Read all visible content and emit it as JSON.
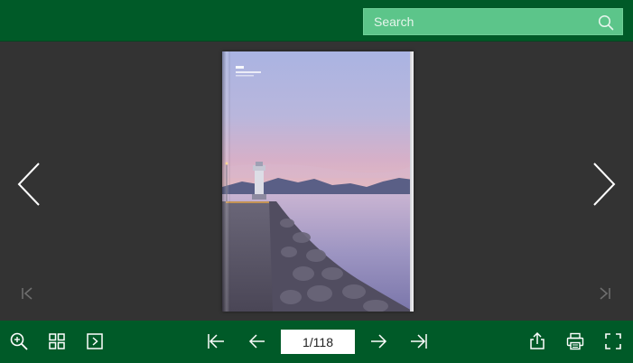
{
  "search": {
    "placeholder": "Search"
  },
  "pagination": {
    "current_page": 1,
    "total_pages": 118,
    "display": "1/118"
  },
  "colors": {
    "bar_green": "#005a28",
    "search_green": "#5cc58a",
    "viewer_background": "#333333",
    "icon_white": "#ffffff"
  },
  "icons": {
    "search": "search-icon",
    "prev_page": "chevron-left-icon",
    "next_page": "chevron-right-icon",
    "first_page": "first-page-icon",
    "last_page": "last-page-icon",
    "zoom": "zoom-in-icon",
    "thumbnails": "grid-icon",
    "autoplay": "play-icon",
    "toolbar_first": "first-page-icon",
    "toolbar_prev": "arrow-left-icon",
    "toolbar_next": "arrow-right-icon",
    "toolbar_last": "last-page-icon",
    "share": "share-icon",
    "print": "print-icon",
    "fullscreen": "fullscreen-icon"
  }
}
